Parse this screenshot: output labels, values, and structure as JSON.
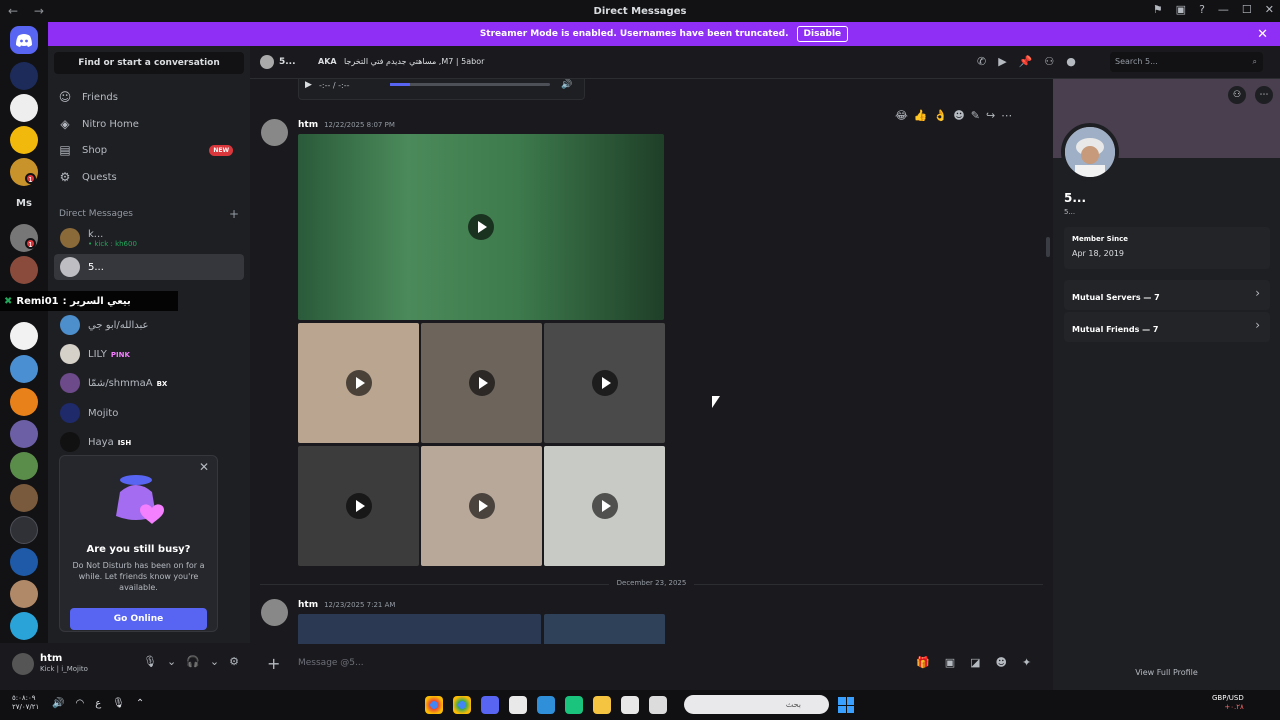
{
  "window": {
    "title": "Direct Messages",
    "nav": "← →",
    "controls": [
      "⚑",
      "▣",
      "?",
      "—",
      "☐",
      "✕"
    ]
  },
  "banner": {
    "text": "Streamer Mode is enabled. Usernames have been truncated.",
    "button": "Disable",
    "close": "✕"
  },
  "servers": [
    {
      "label": "Ms"
    }
  ],
  "server_badges": [
    "1",
    "1"
  ],
  "sidebar": {
    "search": "Find or start a conversation",
    "nav": [
      {
        "label": "Friends",
        "icon": "friends-icon"
      },
      {
        "label": "Nitro Home",
        "icon": "nitro-icon"
      },
      {
        "label": "Shop",
        "icon": "shop-icon",
        "badge": "NEW"
      },
      {
        "label": "Quests",
        "icon": "quests-icon"
      }
    ],
    "dm_header": "Direct Messages",
    "dms": [
      {
        "name": "k...",
        "sub": "• kick : kh600"
      },
      {
        "name": "5...",
        "sub": ""
      },
      {
        "name": "عبدالله/ابو جي",
        "sub": ""
      },
      {
        "name": "LILY",
        "tag": "PINK"
      },
      {
        "name": "شمّا/shmmaA",
        "tag": "BX"
      },
      {
        "name": "Mojito",
        "sub": ""
      },
      {
        "name": "Haya",
        "tag": "ISH"
      }
    ]
  },
  "overlay": {
    "user": "Remi01",
    "text": ": بيعي السرير"
  },
  "busy_popup": {
    "title": "Are you still busy?",
    "body": "Do Not Disturb has been on for a while. Let friends know you're available.",
    "button": "Go Online"
  },
  "user_panel": {
    "name": "htm",
    "status": "Kick | i_Mojito"
  },
  "chat_header": {
    "name": "5...",
    "aka": "AKA",
    "nickname": "مساهتي جديدم فتي التخرجا ,M7 | 5abor",
    "search_placeholder": "Search 5..."
  },
  "audio_player": {
    "time": "-:-- / -:--"
  },
  "messages": [
    {
      "author": "htm",
      "time": "12/22/2025 8:07 PM"
    },
    {
      "author": "htm",
      "time": "12/23/2025 7:21 AM"
    }
  ],
  "date_divider": "December 23, 2025",
  "composer": {
    "placeholder": "Message @5..."
  },
  "profile": {
    "name": "5...",
    "username": "5...",
    "member_since_label": "Member Since",
    "member_since": "Apr 18, 2019",
    "mutual_servers": "Mutual Servers — 7",
    "mutual_friends": "Mutual Friends — 7",
    "view_full": "View Full Profile"
  },
  "taskbar": {
    "time": "٥:٠٨:٠٩",
    "date": "٢٧/٠٧/٢١",
    "search_placeholder": "بحث",
    "fx_pair": "GBP/USD",
    "fx_value": "+٠.٢٨",
    "lang": "ع"
  },
  "colors": {
    "accent": "#5865f2",
    "banner": "#8f2ff5",
    "danger": "#da373c",
    "bg": "#1a1a1e"
  }
}
